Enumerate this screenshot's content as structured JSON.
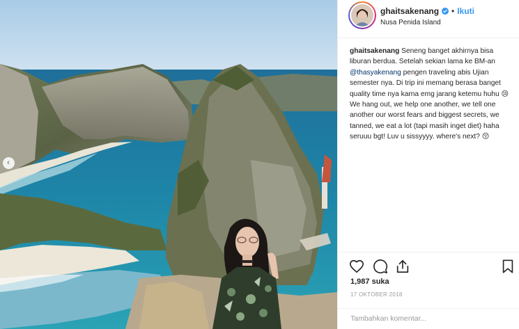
{
  "post": {
    "username": "ghaitsakenang",
    "follow_label": "Ikuti",
    "separator": "•",
    "location": "Nusa Penida Island"
  },
  "caption": {
    "username": "ghaitsakenang",
    "part1": " Seneng banget akhirnya bisa liburan berdua. Setelah sekian lama ke BM-an ",
    "mention": "@thasyakenang",
    "part2": " pengen traveling abis Ujian semester nya. Di trip ini memang berasa banget quality time nya karna emg jarang ketemu huhu 😢 We hang out, we help one another, we tell one another our worst fears and biggest secrets, we tanned, we eat a lot (tapi masih inget diet) haha seruuu bgt! Luv u sissyyyy. where's next? 😚"
  },
  "stats": {
    "likes": "1,987 suka",
    "date": "17 OKTOBER 2018"
  },
  "comment": {
    "placeholder": "Tambahkan komentar..."
  },
  "carousel": {
    "prev_glyph": "‹"
  },
  "colors": {
    "link": "#3897f0",
    "mention": "#003569",
    "text": "#262626",
    "muted": "#999999"
  },
  "icons": [
    "verified-badge-icon",
    "heart-icon",
    "comment-icon",
    "share-icon",
    "bookmark-icon",
    "carousel-prev-icon"
  ]
}
